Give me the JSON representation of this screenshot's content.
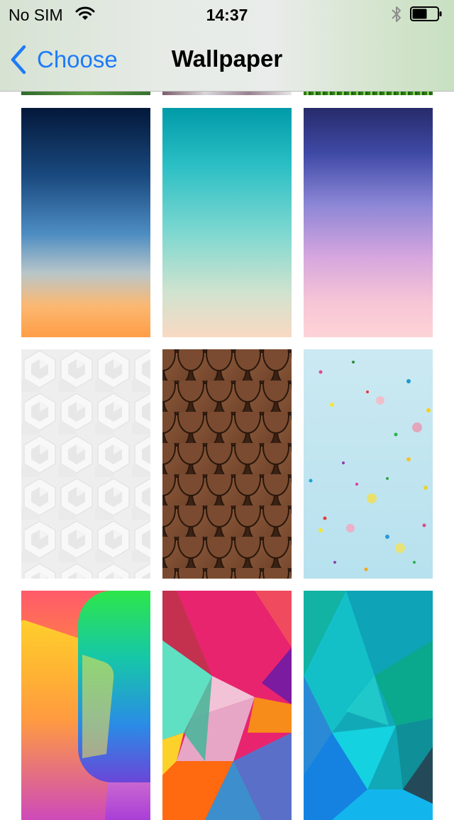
{
  "status_bar": {
    "carrier": "No SIM",
    "time": "14:37",
    "icons": [
      "wifi-icon",
      "bluetooth-icon",
      "battery-icon"
    ]
  },
  "nav": {
    "back_label": "Choose",
    "title": "Wallpaper"
  },
  "colors": {
    "accent": "#1d7bf7"
  },
  "wallpapers": [
    {
      "name": "deep-blue-orange-gradient"
    },
    {
      "name": "teal-peach-gradient"
    },
    {
      "name": "indigo-pink-gradient"
    },
    {
      "name": "white-hexagon-pattern"
    },
    {
      "name": "wooden-scales-pattern"
    },
    {
      "name": "confetti-light-blue"
    },
    {
      "name": "rainbow-rounded-shapes"
    },
    {
      "name": "pink-geometric-triangles"
    },
    {
      "name": "teal-blue-geometric-triangles"
    }
  ]
}
